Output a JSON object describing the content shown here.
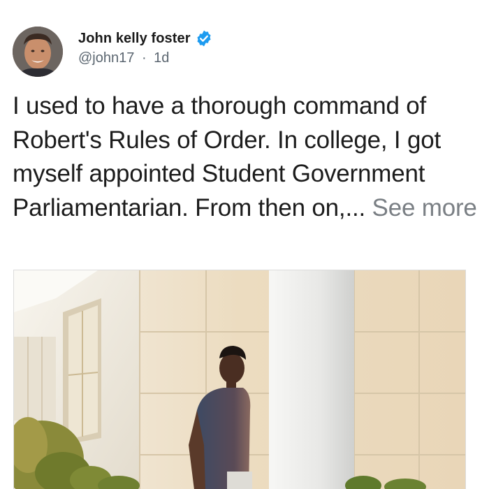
{
  "author": {
    "name": "John kelly foster",
    "handle": "@john17",
    "separator": "·",
    "time": "1d",
    "verified": true
  },
  "post": {
    "text": "I used to have a thorough command of Robert's Rules of Order. In college, I got myself appointed Student Government Parliamentarian. From then on,... ",
    "see_more_label": "See more"
  },
  "colors": {
    "verified_badge": "#1d9bf0",
    "handle": "#5b6670",
    "see_more": "#7a7f84"
  },
  "icons": {
    "verified": "verified-badge-icon"
  }
}
